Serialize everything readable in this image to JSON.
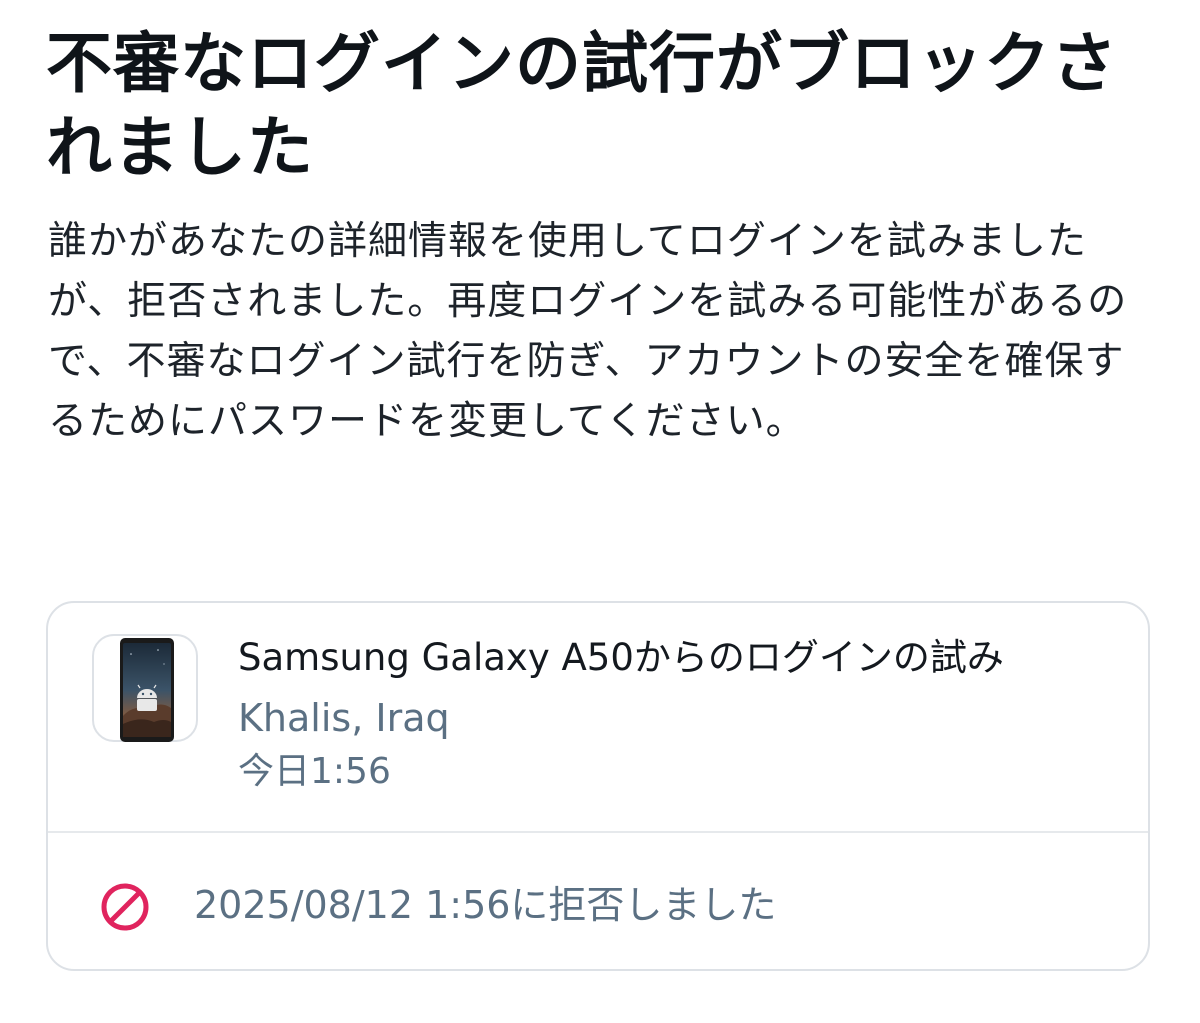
{
  "title": "不審なログインの試行がブロックされました",
  "description": "誰かがあなたの詳細情報を使用してログインを試みましたが、拒否されました。再度ログインを試みる可能性があるので、不審なログイン試行を防ぎ、アカウントの安全を確保するためにパスワードを変更してください。",
  "login_attempt": {
    "device_icon": "android-phone-icon",
    "device_name": "Samsung Galaxy A50からのログインの試み",
    "location": "Khalis, Iraq",
    "time": "今日1:56",
    "status_icon": "prohibited-icon",
    "status_text": "2025/08/12 1:56に拒否しました"
  },
  "colors": {
    "title": "#0f1419",
    "secondary_text": "#5b7083",
    "card_border": "#dde1e6",
    "blocked_icon": "#e0245e"
  }
}
